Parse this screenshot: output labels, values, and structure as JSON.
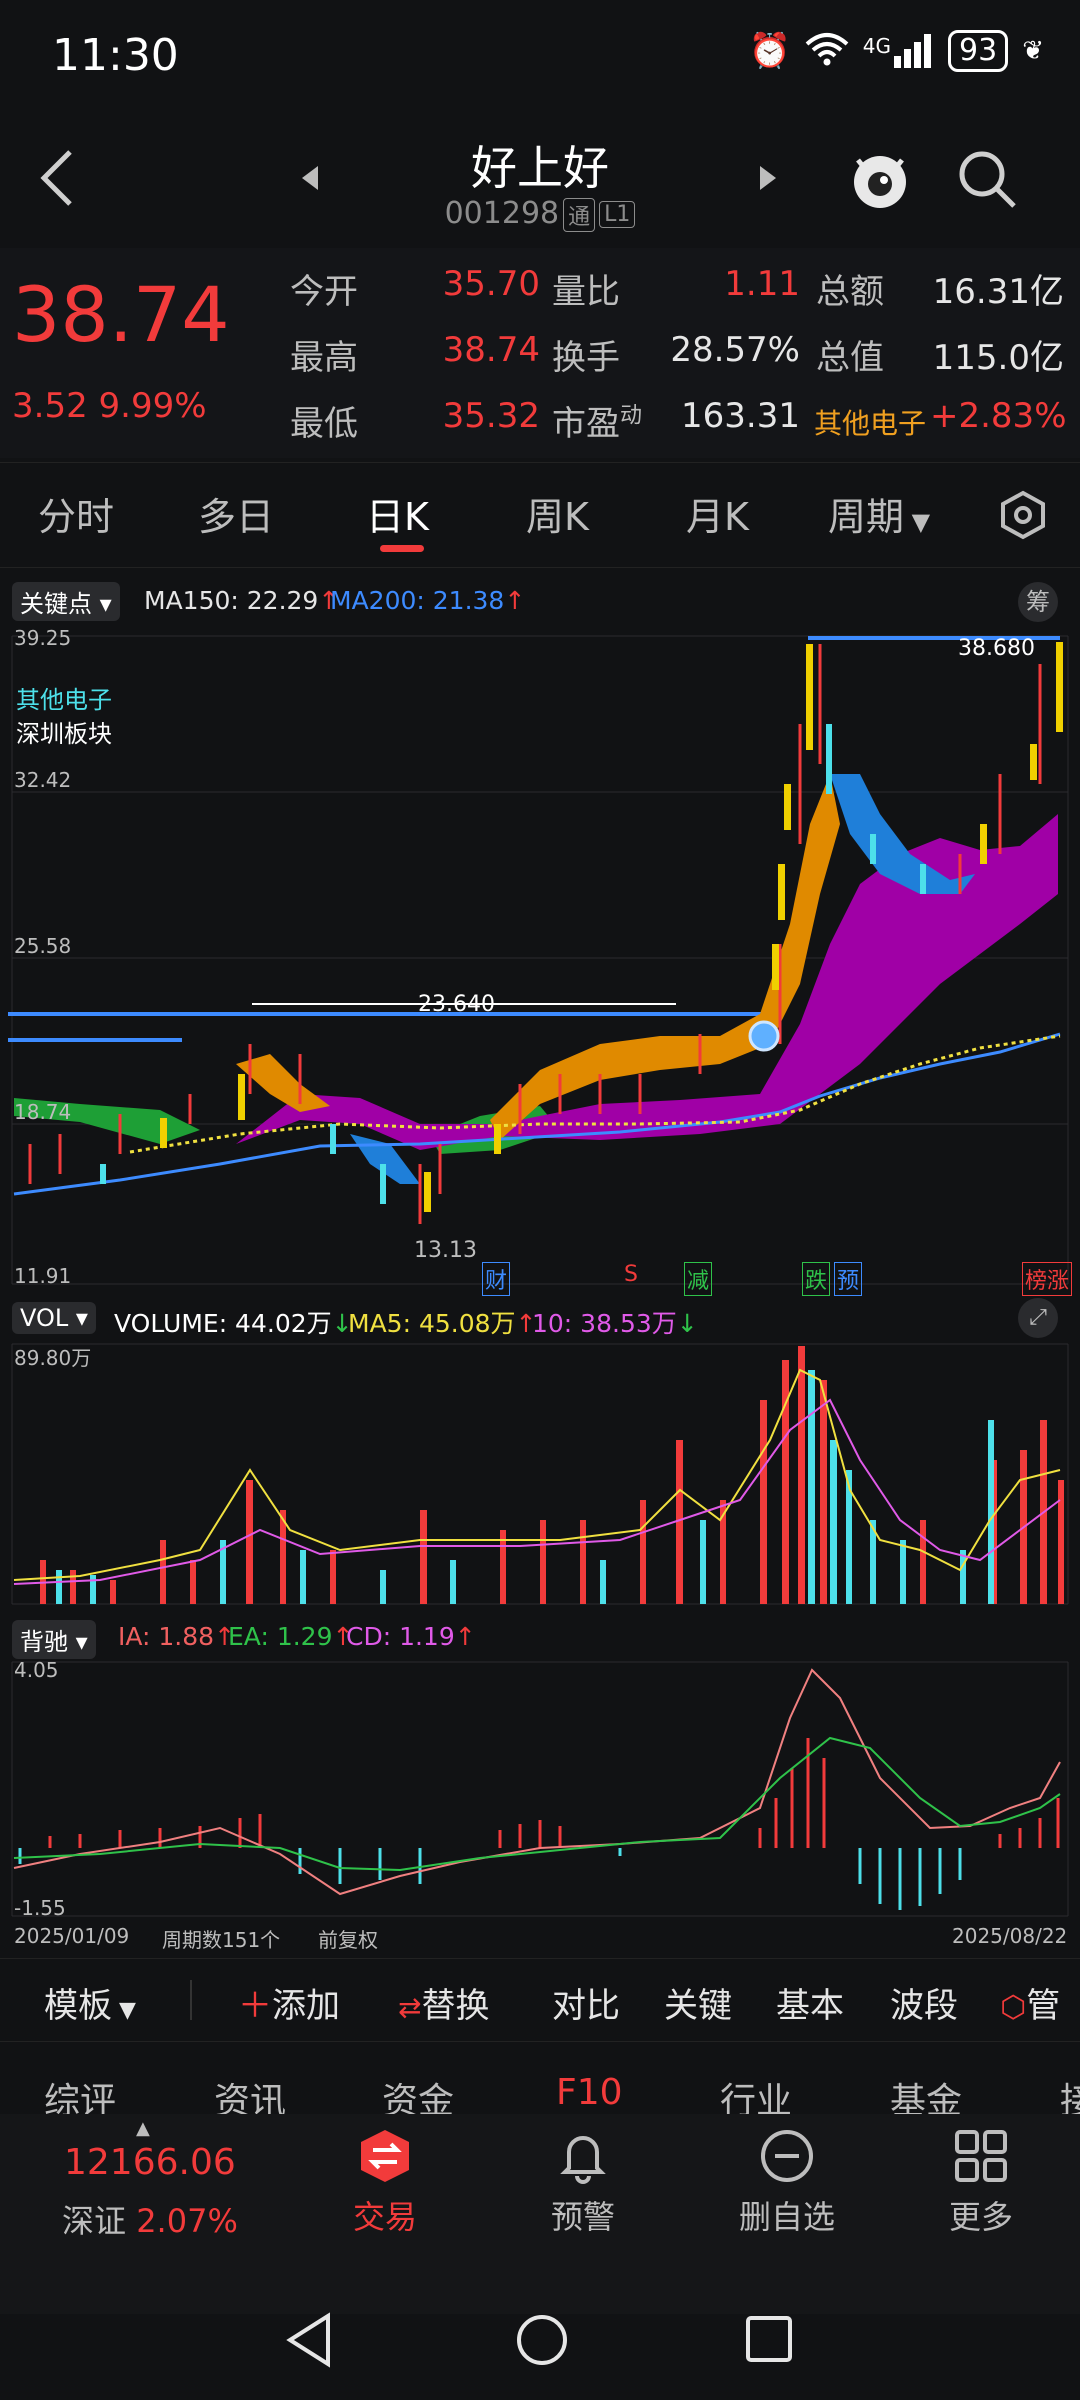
{
  "status_bar": {
    "time": "11:30",
    "battery": "93",
    "network": "4G"
  },
  "header": {
    "title": "好上好",
    "code": "001298",
    "tag1": "通",
    "tag2": "L1"
  },
  "quote": {
    "price": "38.74",
    "change": "3.52",
    "change_pct": "9.99%",
    "rows": [
      {
        "l1": "今开",
        "v1": "35.70",
        "l2": "量比",
        "v2": "1.11",
        "l3": "总额",
        "v3": "16.31亿"
      },
      {
        "l1": "最高",
        "v1": "38.74",
        "l2": "换手",
        "v2": "28.57%",
        "l3": "总值",
        "v3": "115.0亿"
      },
      {
        "l1": "最低",
        "v1": "35.32",
        "l2": "市盈",
        "l2sup": "动",
        "v2": "163.31",
        "l3": "其他电子",
        "v3": "+2.83%"
      }
    ]
  },
  "tabs": [
    {
      "label": "分时"
    },
    {
      "label": "多日"
    },
    {
      "label": "日K",
      "active": true
    },
    {
      "label": "周K"
    },
    {
      "label": "月K"
    },
    {
      "label": "周期"
    }
  ],
  "kline": {
    "selector": "关键点",
    "ma150_label": "MA150: 22.29",
    "ma200_label": "MA200: 21.38",
    "corner_btn": "筹",
    "sector1": "其他电子",
    "sector2": "深圳板块",
    "y_ticks": [
      "39.25",
      "32.42",
      "25.58",
      "18.74",
      "11.91"
    ],
    "high_label": "38.680",
    "line_label": "23.640",
    "low_label": "13.13",
    "events": [
      "财",
      "S",
      "减",
      "跌",
      "预",
      "榜涨"
    ]
  },
  "volume": {
    "selector": "VOL",
    "volume_label": "VOLUME: 44.02万",
    "ma5_label": "MA5: 45.08万",
    "ma10_label": "10: 38.53万",
    "y_max": "89.80万"
  },
  "macd": {
    "selector": "背驰",
    "ia_label": "IA: 1.88",
    "ea_label": "EA: 1.29",
    "cd_label": "CD: 1.19",
    "y_max": "4.05",
    "y_min": "-1.55",
    "date_start": "2025/01/09",
    "period_count": "周期数151个",
    "adjust": "前复权",
    "date_end": "2025/08/22"
  },
  "toolbar": [
    "模板",
    "添加",
    "替换",
    "对比",
    "关键",
    "基本",
    "波段",
    "管"
  ],
  "subtabs": [
    "综评",
    "资讯",
    "资金",
    "F10",
    "行业",
    "基金",
    "接"
  ],
  "bottom_nav": {
    "index_value": "12166.06",
    "index_name": "深证",
    "index_pct": "2.07%",
    "items": [
      "交易",
      "预警",
      "删自选",
      "更多"
    ]
  },
  "colors": {
    "up": "#f23b3b",
    "down": "#2fc24a",
    "bg": "#111214",
    "accent_blue": "#3d8bff"
  }
}
